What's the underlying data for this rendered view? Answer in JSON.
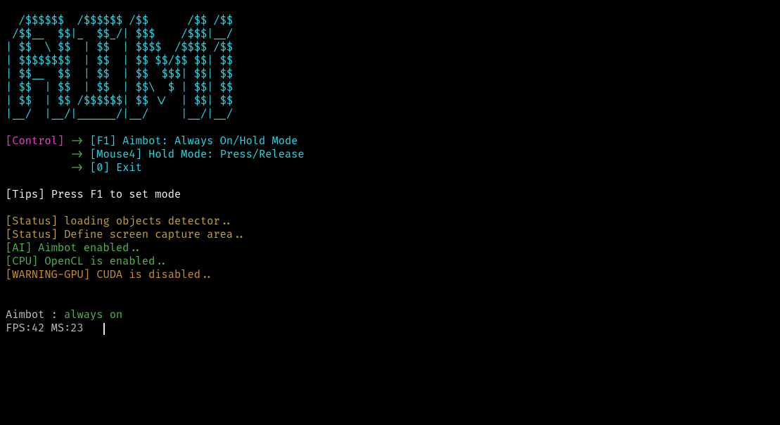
{
  "ascii_logo": [
    "  /$$$$$$  /$$$$$$ /$$      /$$ /$$",
    " /$$__  $$|_  $$_/| $$$    /$$$|__/",
    "| $$  \\ $$  | $$  | $$$$  /$$$$ /$$",
    "| $$$$$$$$  | $$  | $$ $$/$$ $$| $$",
    "| $$__  $$  | $$  | $$  $$$| $$| $$",
    "| $$  | $$  | $$  | $$\\  $ | $$| $$",
    "| $$  | $$ /$$$$$$| $$ \\/  | $$| $$",
    "|__/  |__/|______/|__/     |__/|__/"
  ],
  "controls": {
    "header": "[Control]",
    "arrow": " -> ",
    "lines": [
      {
        "key": "[F1]",
        "desc": " Aimbot: Always On/Hold Mode"
      },
      {
        "key": "[Mouse4]",
        "desc": " Hold Mode: Press/Release"
      },
      {
        "key": "[0]",
        "desc": " Exit"
      }
    ]
  },
  "tips": "[Tips] Press F1 to set mode",
  "status": {
    "loading": "[Status] loading objects detector..",
    "define": "[Status] Define screen capture area..",
    "ai": "[AI] Aimbot enabled..",
    "cpu": "[CPU] OpenCL is enabled..",
    "gpu_warn": "[WARNING-GPU] CUDA is disabled.."
  },
  "aimbot": {
    "label": "Aimbot : ",
    "value": "always on"
  },
  "fps_line": "FPS:42 MS:23   "
}
